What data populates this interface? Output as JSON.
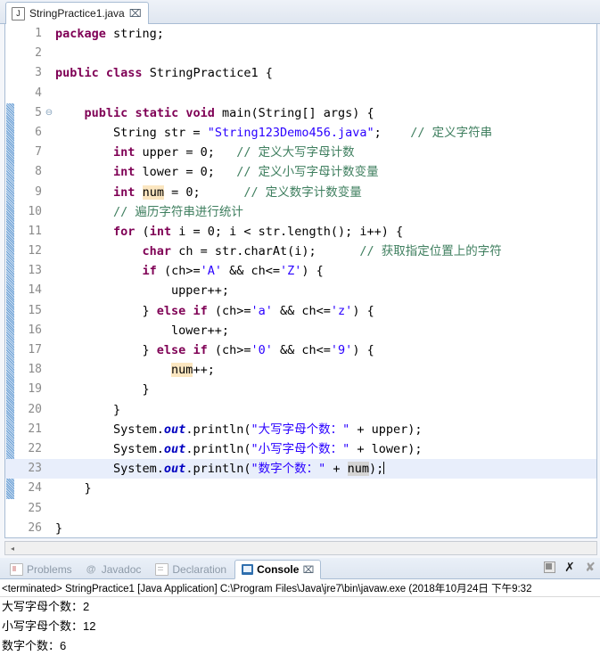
{
  "window": {
    "app": "Eclipse IDE",
    "accent_color": "#a9bdd4"
  },
  "editor": {
    "tab": {
      "icon": "java-file-icon",
      "label": "StringPractice1.java",
      "close_glyph": "⌧"
    },
    "scroll_left_glyph": "◂",
    "lines": [
      {
        "n": "1",
        "fold": "",
        "changed": false,
        "current": false
      },
      {
        "n": "2",
        "fold": "",
        "changed": false,
        "current": false
      },
      {
        "n": "3",
        "fold": "",
        "changed": false,
        "current": false
      },
      {
        "n": "4",
        "fold": "",
        "changed": false,
        "current": false
      },
      {
        "n": "5",
        "fold": "⊖",
        "changed": true,
        "current": false
      },
      {
        "n": "6",
        "fold": "",
        "changed": true,
        "current": false
      },
      {
        "n": "7",
        "fold": "",
        "changed": true,
        "current": false
      },
      {
        "n": "8",
        "fold": "",
        "changed": true,
        "current": false
      },
      {
        "n": "9",
        "fold": "",
        "changed": true,
        "current": false
      },
      {
        "n": "10",
        "fold": "",
        "changed": true,
        "current": false
      },
      {
        "n": "11",
        "fold": "",
        "changed": true,
        "current": false
      },
      {
        "n": "12",
        "fold": "",
        "changed": true,
        "current": false
      },
      {
        "n": "13",
        "fold": "",
        "changed": true,
        "current": false
      },
      {
        "n": "14",
        "fold": "",
        "changed": true,
        "current": false
      },
      {
        "n": "15",
        "fold": "",
        "changed": true,
        "current": false
      },
      {
        "n": "16",
        "fold": "",
        "changed": true,
        "current": false
      },
      {
        "n": "17",
        "fold": "",
        "changed": true,
        "current": false
      },
      {
        "n": "18",
        "fold": "",
        "changed": true,
        "current": false
      },
      {
        "n": "19",
        "fold": "",
        "changed": true,
        "current": false
      },
      {
        "n": "20",
        "fold": "",
        "changed": true,
        "current": false
      },
      {
        "n": "21",
        "fold": "",
        "changed": true,
        "current": false
      },
      {
        "n": "22",
        "fold": "",
        "changed": true,
        "current": false
      },
      {
        "n": "23",
        "fold": "",
        "changed": true,
        "current": true
      },
      {
        "n": "24",
        "fold": "",
        "changed": true,
        "current": false
      },
      {
        "n": "25",
        "fold": "",
        "changed": false,
        "current": false
      },
      {
        "n": "26",
        "fold": "",
        "changed": false,
        "current": false
      }
    ],
    "code_html": [
      "<span class=\"kw\">package</span> string;",
      "",
      "<span class=\"kw\">public</span> <span class=\"kw\">class</span> StringPractice1 {",
      "",
      "    <span class=\"kw\">public</span> <span class=\"kw\">static</span> <span class=\"kw\">void</span> main(String[] args) {",
      "        String str = <span class=\"str\">\"String123Demo456.java\"</span>;    <span class=\"cmt\">// 定义字符串</span>",
      "        <span class=\"kw\">int</span> upper = 0;   <span class=\"cmt\">// 定义大写字母计数</span>",
      "        <span class=\"kw\">int</span> lower = 0;   <span class=\"cmt\">// 定义小写字母计数变量</span>",
      "        <span class=\"kw\">int</span> <span class=\"hl\">num</span> = 0;      <span class=\"cmt\">// 定义数字计数变量</span>",
      "        <span class=\"cmt\">// 遍历字符串进行统计</span>",
      "        <span class=\"kw\">for</span> (<span class=\"kw\">int</span> i = 0; i &lt; str.length(); i++) {",
      "            <span class=\"kw\">char</span> ch = str.charAt(i);      <span class=\"cmt\">// 获取指定位置上的字符</span>",
      "            <span class=\"kw\">if</span> (ch&gt;=<span class=\"str\">'A'</span> &amp;&amp; ch&lt;=<span class=\"str\">'Z'</span>) {",
      "                upper++;",
      "            } <span class=\"kw\">else</span> <span class=\"kw\">if</span> (ch&gt;=<span class=\"str\">'a'</span> &amp;&amp; ch&lt;=<span class=\"str\">'z'</span>) {",
      "                lower++;",
      "            } <span class=\"kw\">else</span> <span class=\"kw\">if</span> (ch&gt;=<span class=\"str\">'0'</span> &amp;&amp; ch&lt;=<span class=\"str\">'9'</span>) {",
      "                <span class=\"hl\">num</span>++;",
      "            }",
      "        }",
      "        System.<span class=\"fld\">out</span>.println(<span class=\"str\">\"大写字母个数：\"</span> + upper);",
      "        System.<span class=\"fld\">out</span>.println(<span class=\"str\">\"小写字母个数：\"</span> + lower);",
      "        System.<span class=\"fld\">out</span>.println(<span class=\"str\">\"数字个数：\"</span> + <span class=\"hl2\">num</span>);<span class=\"caret\"></span>",
      "    }",
      "",
      "}"
    ],
    "code_text": [
      "package string;",
      "",
      "public class StringPractice1 {",
      "",
      "    public static void main(String[] args) {",
      "        String str = \"String123Demo456.java\";    // 定义字符串",
      "        int upper = 0;   // 定义大写字母计数",
      "        int lower = 0;   // 定义小写字母计数变量",
      "        int num = 0;      // 定义数字计数变量",
      "        // 遍历字符串进行统计",
      "        for (int i = 0; i < str.length(); i++) {",
      "            char ch = str.charAt(i);      // 获取指定位置上的字符",
      "            if (ch>='A' && ch<='Z') {",
      "                upper++;",
      "            } else if (ch>='a' && ch<='z') {",
      "                lower++;",
      "            } else if (ch>='0' && ch<='9') {",
      "                num++;",
      "            }",
      "        }",
      "        System.out.println(\"大写字母个数：\" + upper);",
      "        System.out.println(\"小写字母个数：\" + lower);",
      "        System.out.println(\"数字个数：\" + num);",
      "    }",
      "",
      "}"
    ],
    "syntax_colors": {
      "keyword": "#7F0055",
      "string": "#2A00FF",
      "comment": "#3F7F5F",
      "static_field": "#0000C0",
      "occurrence_highlight": "#FBE6C0",
      "write_occurrence_highlight": "#D4D4D4",
      "current_line": "#E8EEFB"
    }
  },
  "console": {
    "tabs": [
      {
        "label": "Problems",
        "icon": "problems-icon",
        "active": false
      },
      {
        "label": "Javadoc",
        "icon": "javadoc-icon",
        "active": false
      },
      {
        "label": "Declaration",
        "icon": "declaration-icon",
        "active": false
      },
      {
        "label": "Console",
        "icon": "console-icon",
        "active": true
      }
    ],
    "close_glyph": "⌧",
    "tools": [
      {
        "name": "terminate-button",
        "glyph": "stop"
      },
      {
        "name": "remove-launch-button",
        "glyph": "✕"
      },
      {
        "name": "remove-all-terminated-button",
        "glyph": "✖"
      }
    ],
    "status_line": "<terminated> StringPractice1 [Java Application] C:\\Program Files\\Java\\jre7\\bin\\javaw.exe (2018年10月24日 下午9:32",
    "output": [
      "大写字母个数：2",
      "小写字母个数：12",
      "数字个数：6"
    ]
  }
}
